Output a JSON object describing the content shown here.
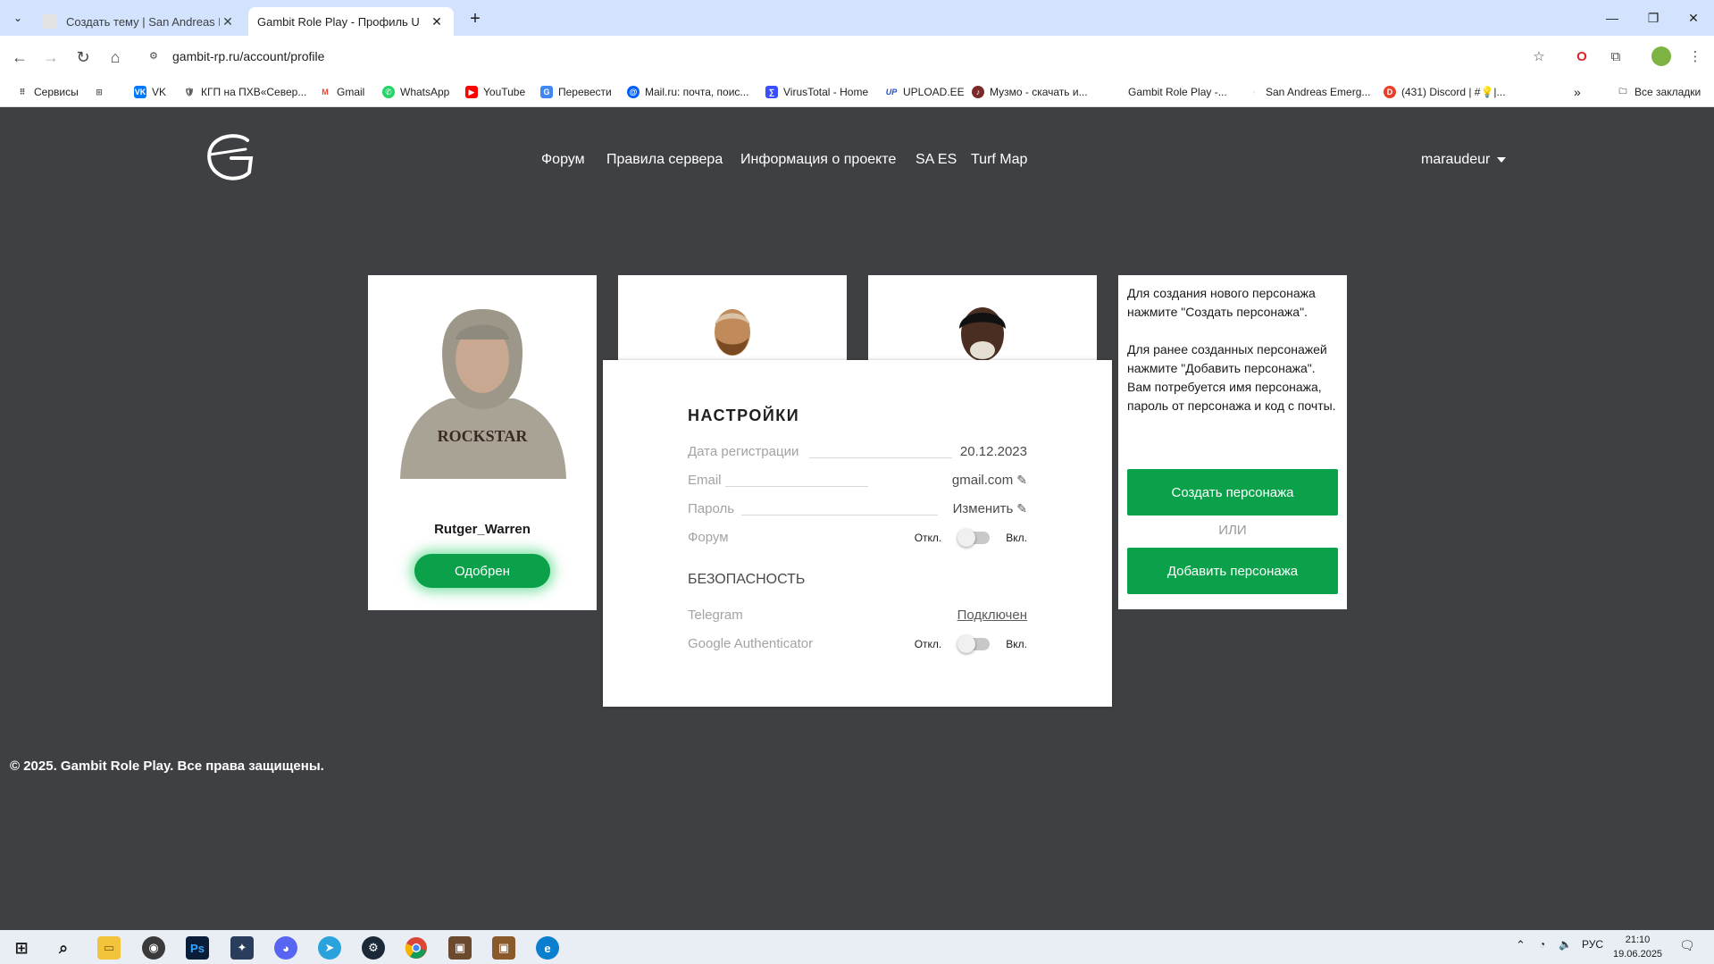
{
  "browser": {
    "tabs": [
      {
        "title": "Создать тему | San Andreas Em",
        "active": false
      },
      {
        "title": "Gambit Role Play - Профиль U",
        "active": true
      }
    ],
    "new_tab_label": "+",
    "url": "gambit-rp.ru/account/profile",
    "bookmarks": [
      {
        "label": "Сервисы",
        "icon": "apps-grid-icon"
      },
      {
        "label": "VK",
        "icon": "vk-icon"
      },
      {
        "label": "КГП на ПХВ«Север...",
        "icon": "shield-icon"
      },
      {
        "label": "Gmail",
        "icon": "gmail-icon"
      },
      {
        "label": "WhatsApp",
        "icon": "whatsapp-icon"
      },
      {
        "label": "YouTube",
        "icon": "youtube-icon"
      },
      {
        "label": "Перевести",
        "icon": "translate-icon"
      },
      {
        "label": "Mail.ru: почта, поис...",
        "icon": "mailru-icon"
      },
      {
        "label": "VirusTotal - Home",
        "icon": "virustotal-icon"
      },
      {
        "label": "UPLOAD.EE",
        "icon": "upload-icon"
      },
      {
        "label": "Музмо - скачать и...",
        "icon": "music-icon"
      },
      {
        "label": "Gambit Role Play -...",
        "icon": "gambit-icon"
      },
      {
        "label": "San Andreas Emerg...",
        "icon": "saes-icon"
      },
      {
        "label": "(431) Discord | #💡|...",
        "icon": "discord-icon"
      }
    ],
    "all_bookmarks_label": "Все закладки"
  },
  "site": {
    "nav": [
      "Форум",
      "Правила сервера",
      "Информация о проекте",
      "SA ES",
      "Turf Map"
    ],
    "username": "maraudeur"
  },
  "character": {
    "name": "Rutger_Warren",
    "status": "Одобрен"
  },
  "settings": {
    "title": "НАСТРОЙКИ",
    "registration_label": "Дата регистрации",
    "registration_value": "20.12.2023",
    "email_label": "Email",
    "email_value": "gmail.com",
    "password_label": "Пароль",
    "password_value": "Изменить",
    "forum_label": "Форум",
    "off_label": "Откл.",
    "on_label": "Вкл.",
    "security_title": "БЕЗОПАСНОСТЬ",
    "telegram_label": "Telegram",
    "telegram_value": "Подключен",
    "ga_label": "Google Authenticator"
  },
  "info": {
    "text1": "Для создания нового персонажа нажмите \"Создать персонажа\".",
    "text2": "Для ранее созданных персонажей нажмите \"Добавить персонажа\". Вам потребуется имя персонажа, пароль от персонажа и код с почты.",
    "create_button": "Создать персонажа",
    "or_label": "ИЛИ",
    "add_button": "Добавить персонажа"
  },
  "footer": "© 2025. Gambit Role Play. Все права защищены.",
  "taskbar": {
    "language": "РУС",
    "time": "21:10",
    "date": "19.06.2025"
  },
  "colors": {
    "page_bg": "#3f4043",
    "accent_green": "#0aa14a"
  }
}
